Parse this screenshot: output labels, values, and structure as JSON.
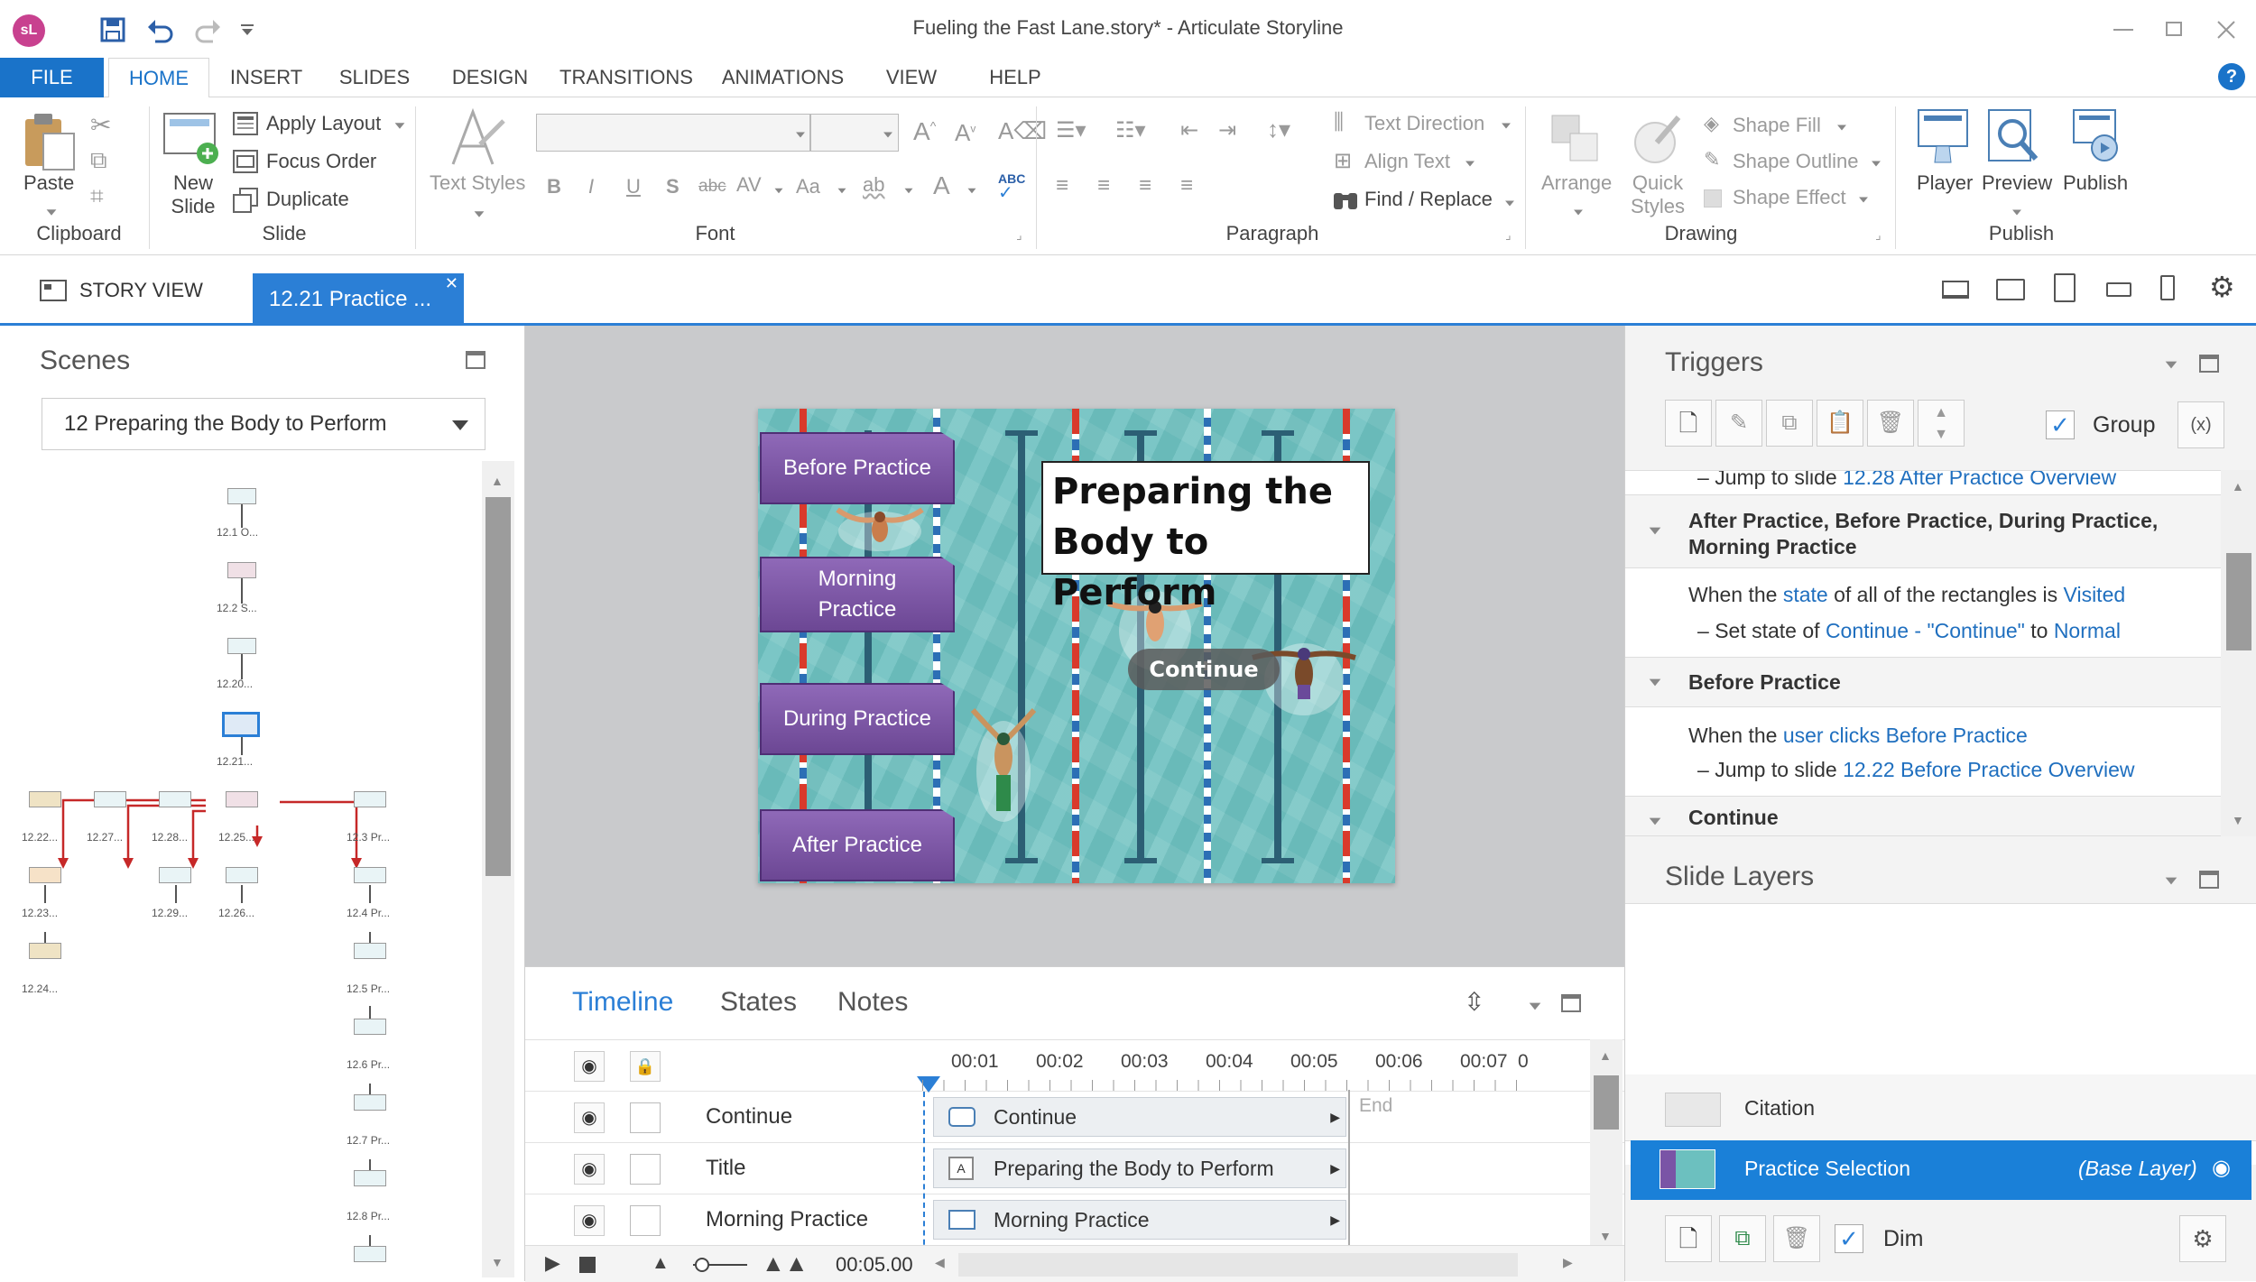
{
  "window": {
    "title": "Fueling the Fast Lane.story* -  Articulate Storyline",
    "app_badge": "sL"
  },
  "menu": {
    "tabs": [
      "FILE",
      "HOME",
      "INSERT",
      "SLIDES",
      "DESIGN",
      "TRANSITIONS",
      "ANIMATIONS",
      "VIEW",
      "HELP"
    ],
    "active": "HOME"
  },
  "ribbon": {
    "clipboard": {
      "paste": "Paste",
      "group": "Clipboard"
    },
    "slide": {
      "new_slide": "New Slide",
      "apply_layout": "Apply Layout",
      "focus_order": "Focus Order",
      "duplicate": "Duplicate",
      "group": "Slide"
    },
    "font": {
      "text_styles": "Text Styles",
      "group": "Font",
      "bold": "B",
      "italic": "I",
      "underline": "U",
      "shadow": "S",
      "strike": "abc",
      "spacing": "AV",
      "case": "Aa",
      "clear": "ab"
    },
    "paragraph": {
      "text_direction": "Text Direction",
      "align_text": "Align Text",
      "find_replace": "Find / Replace",
      "group": "Paragraph"
    },
    "drawing": {
      "arrange": "Arrange",
      "quick_styles": "Quick Styles",
      "shape_fill": "Shape Fill",
      "shape_outline": "Shape Outline",
      "shape_effect": "Shape Effect",
      "group": "Drawing"
    },
    "publish": {
      "player": "Player",
      "preview": "Preview",
      "publish": "Publish",
      "group": "Publish"
    }
  },
  "docbar": {
    "story_view": "STORY VIEW",
    "active_tab": "12.21 Practice ..."
  },
  "scenes": {
    "title": "Scenes",
    "selected": "12 Preparing the Body to Perform",
    "node_labels": [
      "12.1 O...",
      "12.2 S...",
      "12.20...",
      "12.21...",
      "12.22...",
      "12.27...",
      "12.28...",
      "12.25...",
      "12.3 Pr...",
      "12.23...",
      "12.29...",
      "12.26...",
      "12.4 Pr...",
      "12.24...",
      "12.5 Pr...",
      "12.6 Pr...",
      "12.7 Pr...",
      "12.8 Pr..."
    ]
  },
  "slide": {
    "title_line1": "Preparing the",
    "title_line2": "Body to Perform",
    "continue": "Continue",
    "buttons": [
      "Before Practice",
      "Morning Practice",
      "During Practice",
      "After Practice"
    ]
  },
  "timeline": {
    "tabs": [
      "Timeline",
      "States",
      "Notes"
    ],
    "ticks": [
      "00:01",
      "00:02",
      "00:03",
      "00:04",
      "00:05",
      "00:06",
      "00:07",
      "0"
    ],
    "end_label": "End",
    "rows": [
      {
        "name": "Continue",
        "bar": "Continue"
      },
      {
        "name": "Title",
        "bar": "Preparing the Body to Perform"
      },
      {
        "name": "Morning Practice",
        "bar": "Morning Practice"
      }
    ],
    "duration": "00:05.00"
  },
  "triggers": {
    "title": "Triggers",
    "group_label": "Group",
    "group_checked": true,
    "top_line": {
      "prefix": "Jump to slide ",
      "link": "12.28 After Practice Overview"
    },
    "sec1_title": "After Practice, Before Practice, During Practice, Morning Practice",
    "sec1_line1": {
      "a": "When the ",
      "b": "state",
      "c": " of all of the rectangles is ",
      "d": "Visited"
    },
    "sec1_line2": {
      "a": "Set state of ",
      "b": "Continue - \"Continue\"",
      "c": " to ",
      "d": "Normal"
    },
    "sec2_title": "Before Practice",
    "sec2_line1": {
      "a": "When the ",
      "b": "user clicks",
      "c": " ",
      "d": "Before Practice"
    },
    "sec2_line2": {
      "a": "Jump to slide ",
      "b": "12.22 Before Practice Overview"
    },
    "sec3_partial": "Continue"
  },
  "layers": {
    "title": "Slide Layers",
    "citation": "Citation",
    "base": "Practice Selection",
    "base_tag": "(Base Layer)",
    "dim": "Dim",
    "dim_checked": true
  },
  "colors": {
    "accent": "#2b7fd6",
    "file_tab": "#1a73c9",
    "purple": "#7a54a6",
    "pool": "#6fbfbe",
    "link": "#1f6fbf",
    "selected_row": "#1a80d8"
  }
}
